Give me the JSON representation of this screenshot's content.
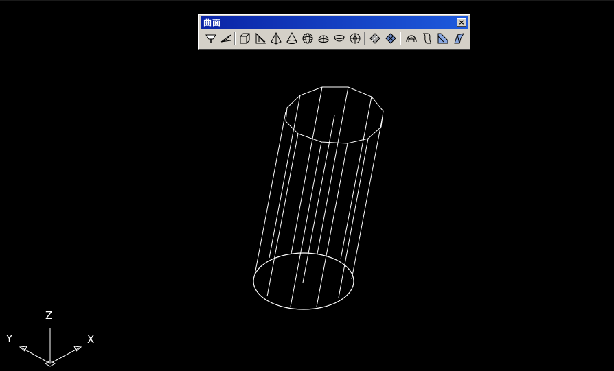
{
  "toolbar": {
    "title": "曲面",
    "close_label": "×",
    "buttons": [
      {
        "name": "2d-solid-icon"
      },
      {
        "name": "3d-face-icon"
      },
      {
        "name": "box-icon"
      },
      {
        "name": "wedge-icon"
      },
      {
        "name": "pyramid-icon"
      },
      {
        "name": "cone-icon"
      },
      {
        "name": "sphere-icon"
      },
      {
        "name": "dome-icon"
      },
      {
        "name": "dish-icon"
      },
      {
        "name": "torus-icon"
      },
      {
        "name": "edge-icon"
      },
      {
        "name": "3d-mesh-icon"
      },
      {
        "name": "revolved-surface-icon"
      },
      {
        "name": "tabulated-surface-icon"
      },
      {
        "name": "ruled-surface-icon"
      },
      {
        "name": "edge-surface-icon"
      }
    ]
  },
  "ucs": {
    "z_label": "Z",
    "y_label": "Y",
    "x_label": "X"
  },
  "colors": {
    "background": "#000000",
    "wireframe": "#ffffff",
    "toolbar_face": "#d4d0c8",
    "titlebar": "#0a24a6"
  }
}
